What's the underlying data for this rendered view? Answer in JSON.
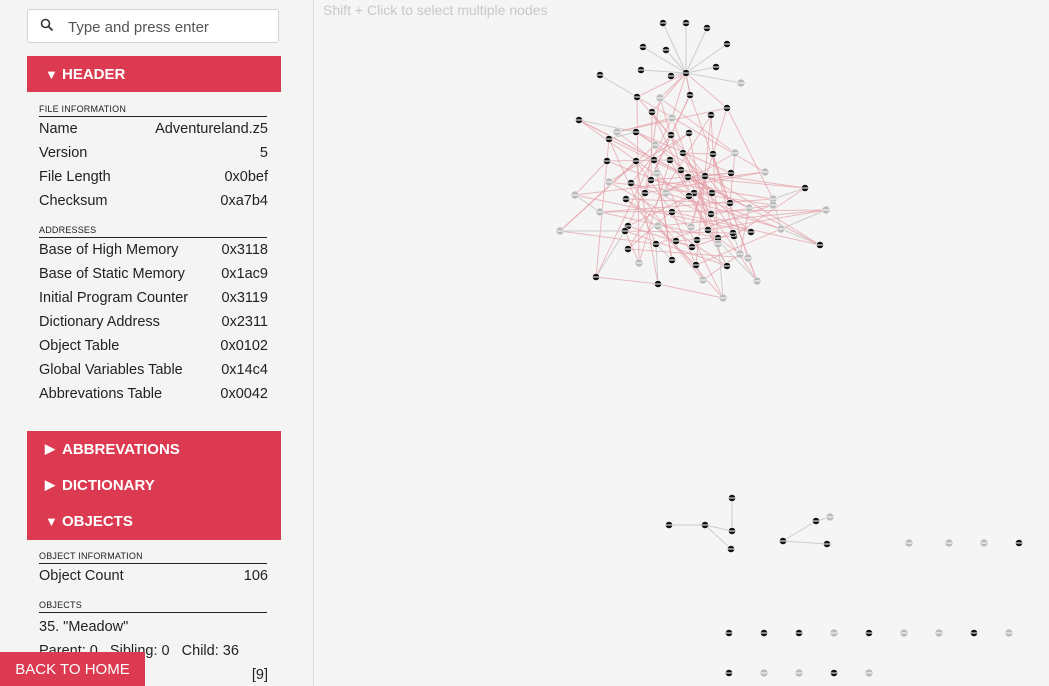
{
  "search": {
    "placeholder": "Type and press enter"
  },
  "header_section": {
    "label": "HEADER",
    "arrow": "▼"
  },
  "file_information": {
    "title": "FILE INFORMATION",
    "rows": [
      {
        "key": "Name",
        "value": "Adventureland.z5"
      },
      {
        "key": "Version",
        "value": "5"
      },
      {
        "key": "File Length",
        "value": "0x0bef"
      },
      {
        "key": "Checksum",
        "value": "0xa7b4"
      }
    ]
  },
  "addresses": {
    "title": "ADDRESSES",
    "rows": [
      {
        "key": "Base of High Memory",
        "value": "0x3118"
      },
      {
        "key": "Base of Static Memory",
        "value": "0x1ac9"
      },
      {
        "key": "Initial Program Counter",
        "value": "0x3119"
      },
      {
        "key": "Dictionary Address",
        "value": "0x2311"
      },
      {
        "key": "Object Table",
        "value": "0x0102"
      },
      {
        "key": "Global Variables Table",
        "value": "0x14c4"
      },
      {
        "key": "Abbrevations Table",
        "value": "0x0042"
      }
    ]
  },
  "menu": [
    {
      "label": "ABBREVATIONS",
      "arrow": "▶"
    },
    {
      "label": "DICTIONARY",
      "arrow": "▶"
    },
    {
      "label": "OBJECTS",
      "arrow": "▼"
    }
  ],
  "object_information": {
    "title": "OBJECT INFORMATION",
    "count_label": "Object Count",
    "count_value": "106"
  },
  "objects": {
    "title": "OBJECTS",
    "selected": "35. \"Meadow\"",
    "relations": "Parent: 0   Sibling: 0   Child: 36",
    "extra": "[9]"
  },
  "hint": "Shift + Click to select multiple nodes",
  "back_button": "BACK TO HOME",
  "colors": {
    "accent": "#dc3a50",
    "edge_red": "#e4a0a8",
    "edge_gray": "#c8c8c8",
    "node": "#111111"
  }
}
